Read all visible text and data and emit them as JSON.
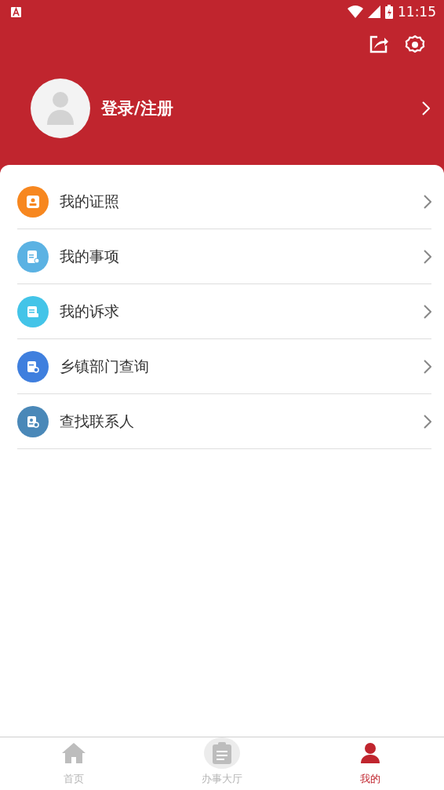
{
  "status_bar": {
    "time": "11:15"
  },
  "profile": {
    "login_label": "登录/注册"
  },
  "menu": [
    {
      "label": "我的证照",
      "kind": "id-card",
      "color": "#f7871f"
    },
    {
      "label": "我的事项",
      "kind": "clipboard",
      "color": "#5bb2e3"
    },
    {
      "label": "我的诉求",
      "kind": "message",
      "color": "#43c4e8"
    },
    {
      "label": "乡镇部门查询",
      "kind": "search-doc",
      "color": "#3f7fde"
    },
    {
      "label": "查找联系人",
      "kind": "contact",
      "color": "#4a88b8"
    }
  ],
  "tabs": [
    {
      "label": "首页",
      "kind": "home",
      "selected": false
    },
    {
      "label": "办事大厅",
      "kind": "clipboard",
      "selected": false
    },
    {
      "label": "我的",
      "kind": "person",
      "selected": true
    }
  ]
}
